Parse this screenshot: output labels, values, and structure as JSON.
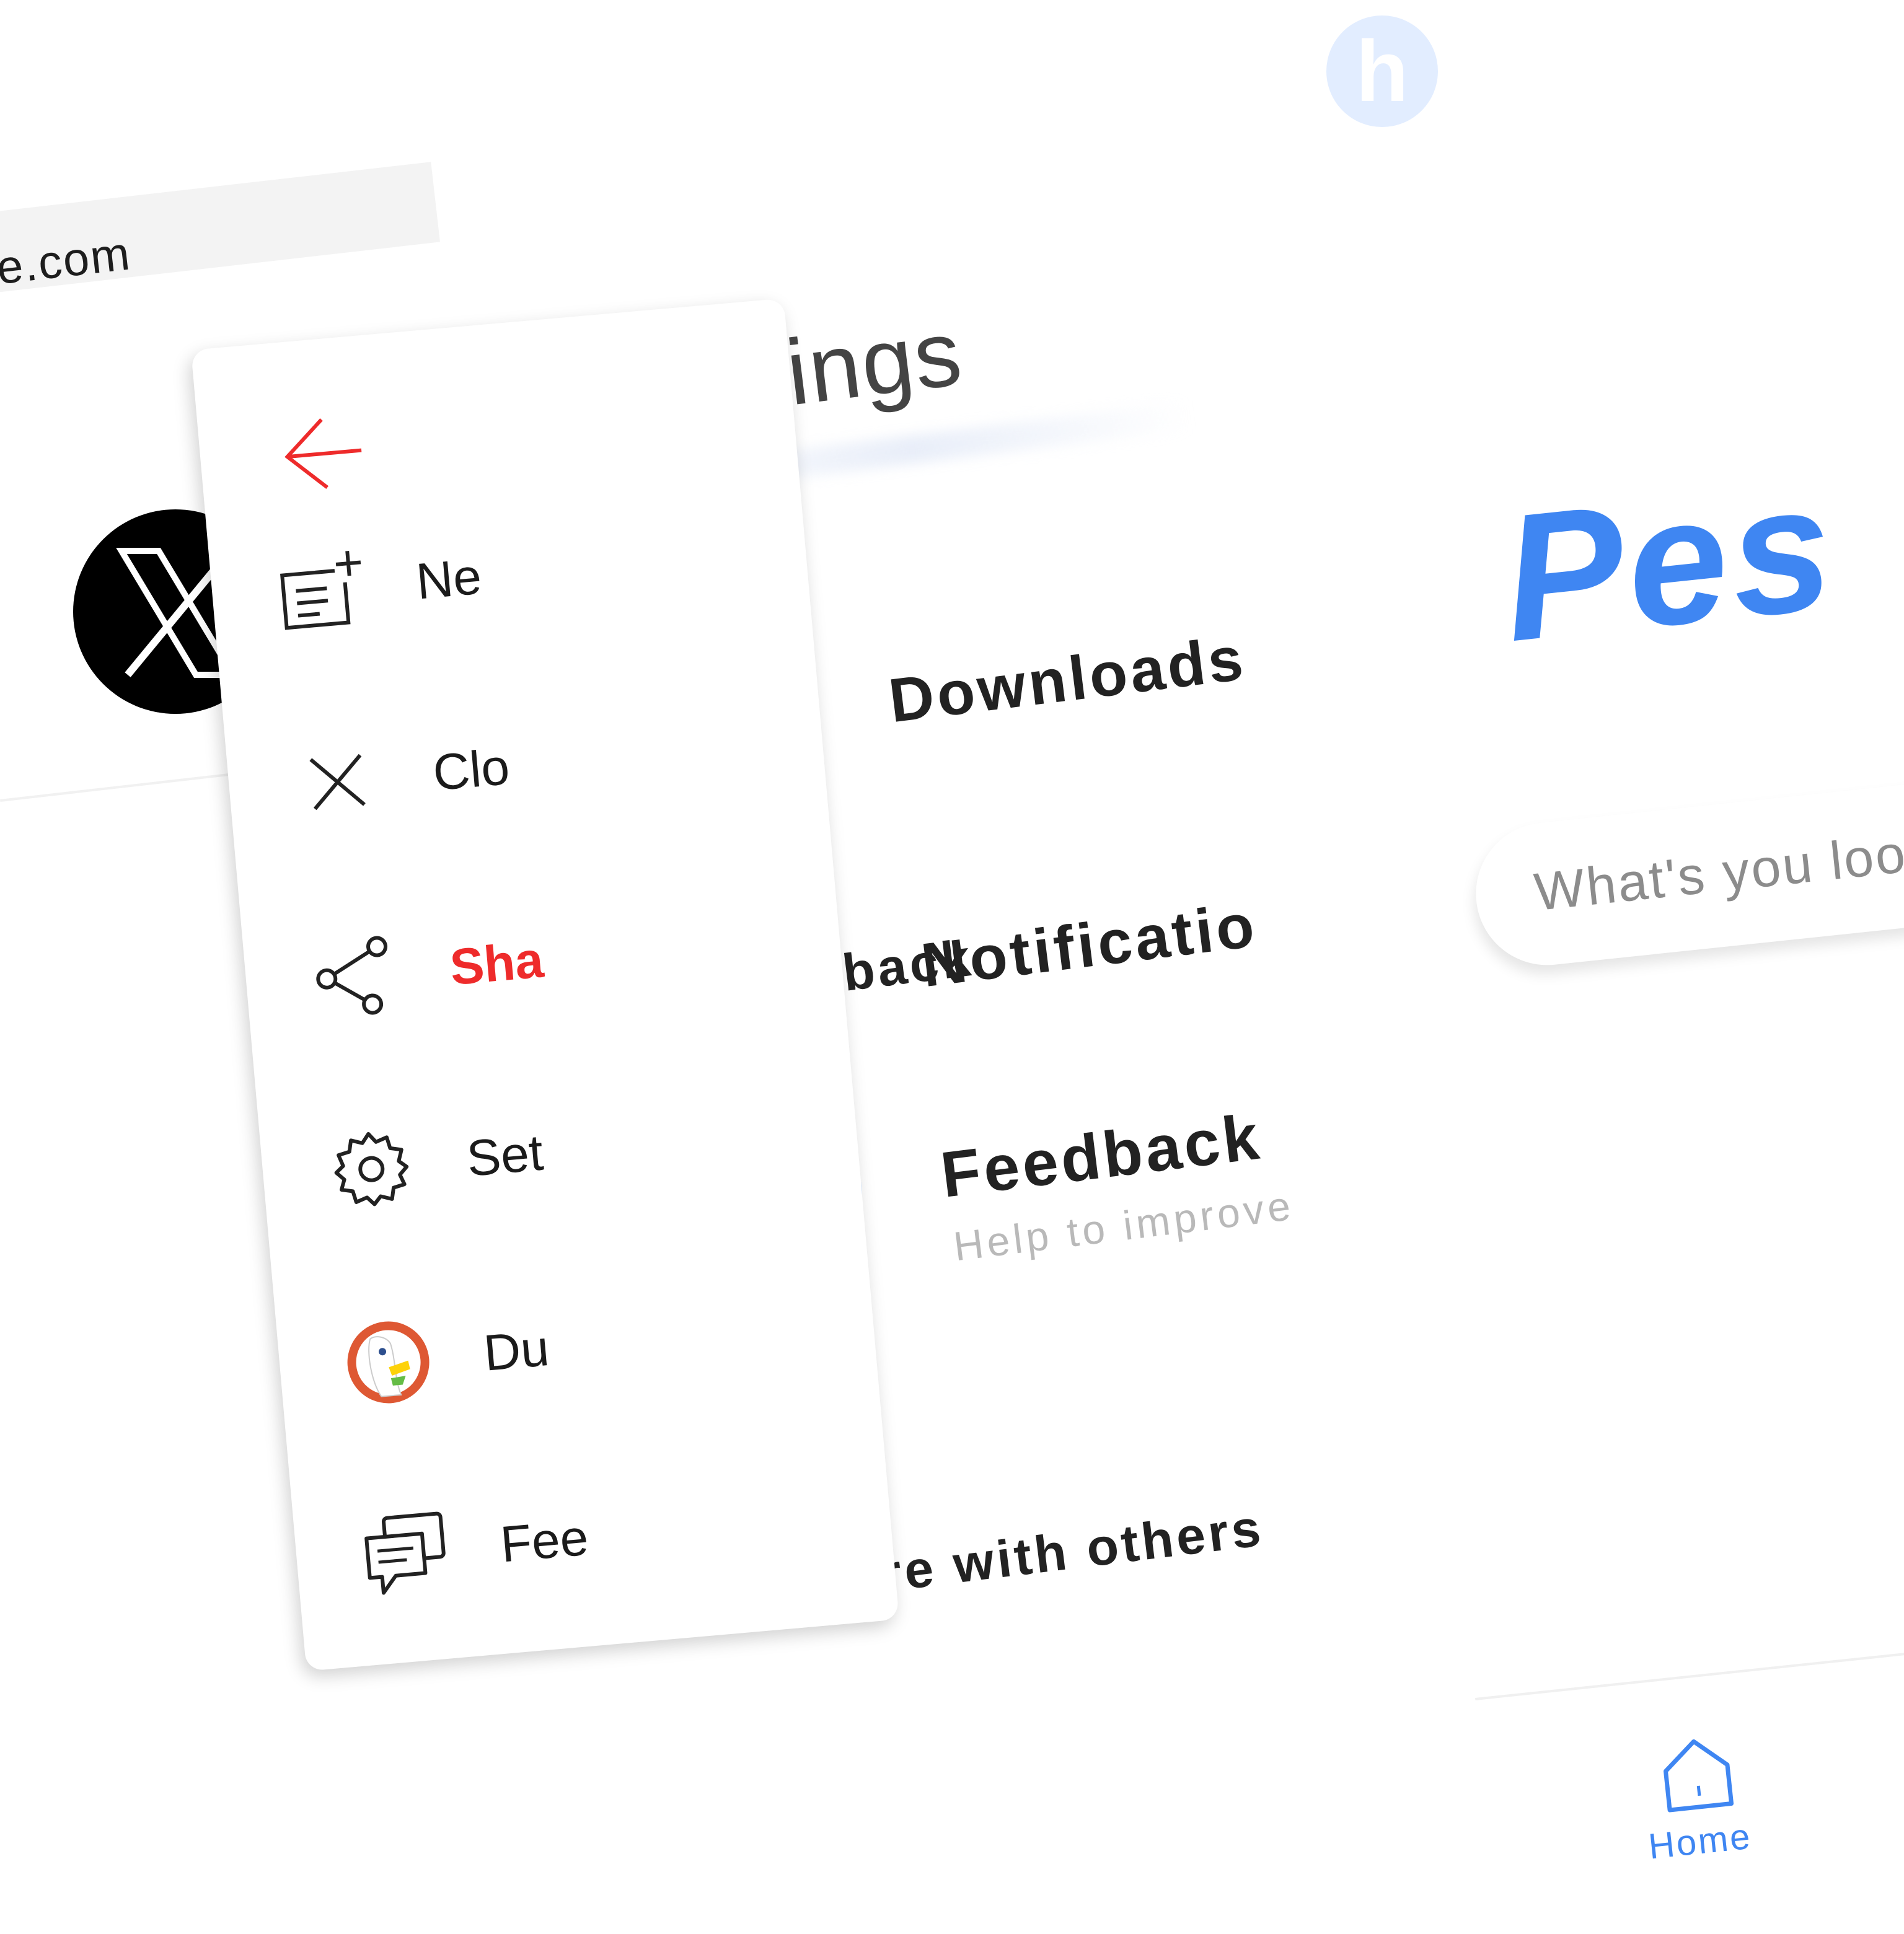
{
  "background_page": {
    "url_text": "e.com",
    "site_icon": "x-logo-icon"
  },
  "menu": {
    "back_icon": "arrow-left-icon",
    "accent_color": "#ee2b2b",
    "items": [
      {
        "label": "Ne",
        "icon": "new-tab-icon"
      },
      {
        "label": "Clo",
        "icon": "close-icon"
      },
      {
        "label": "Sha",
        "icon": "share-icon",
        "highlighted": true
      },
      {
        "label": "Set",
        "icon": "gear-icon"
      },
      {
        "label": "Du",
        "icon": "duckduckgo-icon"
      },
      {
        "label": "Fee",
        "icon": "feedback-icon"
      }
    ]
  },
  "settings": {
    "title": "Settings",
    "icon_color": "#a9cdff",
    "rows": [
      {
        "label": "Downloads",
        "icon": "download-icon"
      },
      {
        "label": "Notificatio",
        "icon": "bell-icon"
      }
    ],
    "sections": {
      "feedback": "Feedback",
      "share": "Share with others"
    },
    "feedback_row": {
      "label": "Feedback",
      "sublabel": "Help to improve",
      "icon": "chat-bubbles-icon"
    }
  },
  "right_page": {
    "avatar_letter": "h",
    "logo_text": "Pes",
    "brand_color": "#3f86f2",
    "search_placeholder": "What's you look",
    "nav": {
      "home_label": "Home",
      "home_icon": "home-icon"
    }
  }
}
